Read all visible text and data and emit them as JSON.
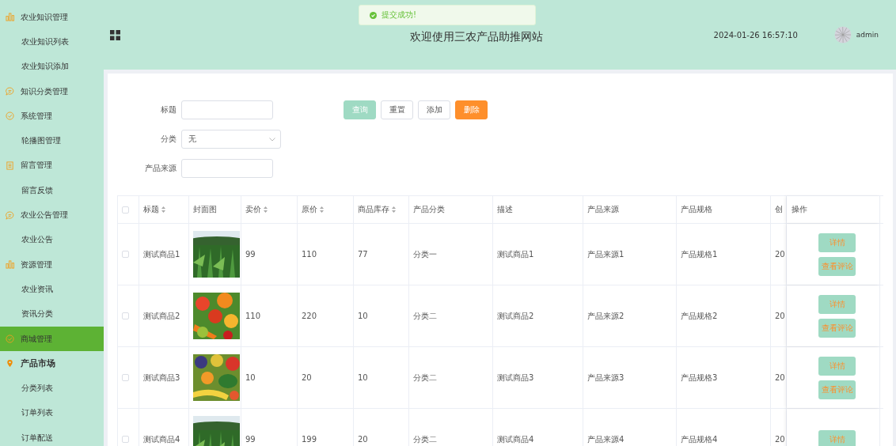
{
  "sidebar": {
    "groups": [
      {
        "label": "农业知识管理",
        "selected": false,
        "children": [
          {
            "label": "农业知识列表"
          },
          {
            "label": "农业知识添加"
          }
        ]
      },
      {
        "label": "知识分类管理",
        "selected": false
      },
      {
        "label": "系统管理",
        "selected": false,
        "children": [
          {
            "label": "轮播图管理"
          }
        ]
      },
      {
        "label": "留言管理",
        "selected": false,
        "children": [
          {
            "label": "留言反馈"
          }
        ]
      },
      {
        "label": "农业公告管理",
        "selected": false,
        "children": [
          {
            "label": "农业公告"
          }
        ]
      },
      {
        "label": "资源管理",
        "selected": false,
        "children": [
          {
            "label": "农业资讯"
          },
          {
            "label": "资讯分类"
          }
        ]
      },
      {
        "label": "商城管理",
        "selected": true
      },
      {
        "label": "产品市场",
        "selected": false,
        "children": [
          {
            "label": "分类列表"
          },
          {
            "label": "订单列表"
          },
          {
            "label": "订单配送"
          }
        ]
      }
    ]
  },
  "header": {
    "title": "欢迎使用三农产品助推网站",
    "datetime": "2024-01-26 16:57:10",
    "user": "admin"
  },
  "toast": {
    "message": "提交成功!"
  },
  "filters": [
    {
      "kind": "input",
      "label": "标题"
    },
    {
      "kind": "select",
      "label": "分类",
      "value": "无"
    },
    {
      "kind": "input",
      "label": "产品来源"
    }
  ],
  "actions": [
    {
      "kind": "primary",
      "label": "查询"
    },
    {
      "kind": "plain",
      "label": "重置"
    },
    {
      "kind": "plain",
      "label": "添加"
    },
    {
      "kind": "danger",
      "label": "删除"
    }
  ],
  "table": {
    "select_all_checked": false,
    "columns": [
      {
        "label": "标题",
        "sortable": true
      },
      {
        "label": "封面图",
        "sortable": false
      },
      {
        "label": "卖价",
        "sortable": true
      },
      {
        "label": "原价",
        "sortable": true
      },
      {
        "label": "商品库存",
        "sortable": true
      },
      {
        "label": "产品分类",
        "sortable": false
      },
      {
        "label": "描述",
        "sortable": false
      },
      {
        "label": "产品来源",
        "sortable": false
      },
      {
        "label": "产品规格",
        "sortable": false
      },
      {
        "label": "创"
      },
      {
        "label": "操作",
        "sortable": false
      }
    ],
    "rows": [
      {
        "checked": false,
        "title": "测试商品1",
        "cover": {
          "kind": "picture"
        },
        "price": "99",
        "original_price": "110",
        "stock": "77",
        "category": "分类一",
        "description": "测试商品1",
        "source": "产品来源1",
        "spec": "产品规格1",
        "created": "20",
        "buttons": [
          "详情",
          "查看评论"
        ]
      },
      {
        "checked": false,
        "title": "测试商品2",
        "cover": {
          "kind": "picture"
        },
        "price": "110",
        "original_price": "220",
        "stock": "10",
        "category": "分类二",
        "description": "测试商品2",
        "source": "产品来源2",
        "spec": "产品规格2",
        "created": "20",
        "buttons": [
          "详情",
          "查看评论"
        ]
      },
      {
        "checked": false,
        "title": "测试商品3",
        "cover": {
          "kind": "picture"
        },
        "price": "10",
        "original_price": "20",
        "stock": "10",
        "category": "分类二",
        "description": "测试商品3",
        "source": "产品来源3",
        "spec": "产品规格3",
        "created": "20",
        "buttons": [
          "详情",
          "查看评论"
        ]
      },
      {
        "checked": false,
        "title": "测试商品4",
        "cover": {
          "kind": "picture"
        },
        "price": "99",
        "original_price": "199",
        "stock": "20",
        "category": "分类二",
        "description": "测试商品4",
        "source": "产品来源4",
        "spec": "产品规格4",
        "created": "20",
        "buttons": [
          "详情"
        ]
      }
    ]
  }
}
